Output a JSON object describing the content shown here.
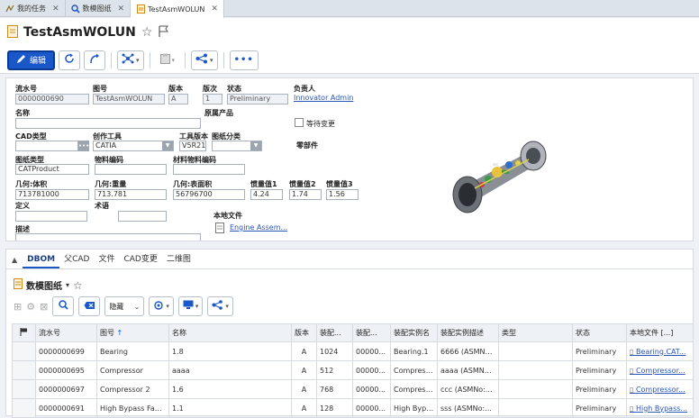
{
  "tabs": [
    {
      "label": "我的任务",
      "icon": "task-icon"
    },
    {
      "label": "数模图纸",
      "icon": "search-icon"
    },
    {
      "label": "TestAsmWOLUN",
      "icon": "document-icon",
      "active": true
    }
  ],
  "header": {
    "title": "TestAsmWOLUN"
  },
  "toolbar": {
    "edit_label": "编辑"
  },
  "form": {
    "lbl_serial": "流水号",
    "serial": "0000000690",
    "lbl_drawing_no": "图号",
    "drawing_no": "TestAsmWOLUN",
    "lbl_version": "版本",
    "version": "A",
    "lbl_revision": "版次",
    "revision": "1",
    "lbl_status": "状态",
    "status": "Preliminary",
    "lbl_owner": "负责人",
    "owner": "Innovator Admin",
    "lbl_name": "名称",
    "lbl_source_product": "原属产品",
    "lbl_pending_change": "等待变更",
    "lbl_cad_type": "CAD类型",
    "lbl_authoring_tool": "创作工具",
    "authoring_tool": "CATIA",
    "lbl_tool_version": "工具版本",
    "tool_version": "V5R21",
    "lbl_drawing_category": "图纸分类",
    "lbl_part": "零部件",
    "lbl_drawing_type": "图纸类型",
    "drawing_type": "CATProduct",
    "lbl_material_code": "物料编码",
    "lbl_material_material_code": "材料物料编码",
    "lbl_volume": "几何:体积",
    "volume": "713781000",
    "lbl_weight": "几何:重量",
    "weight": "713.781",
    "lbl_surface": "几何:表面积",
    "surface": "56796700",
    "lbl_inertia1": "惯量值1",
    "inertia1": "4.24",
    "lbl_inertia2": "惯量值2",
    "inertia2": "1.74",
    "lbl_inertia3": "惯量值3",
    "inertia3": "1.56",
    "lbl_definition": "定义",
    "lbl_term": "术语",
    "lbl_local_file": "本地文件",
    "local_file": "Engine Assem...",
    "lbl_description": "描述"
  },
  "bottom": {
    "subtabs": [
      "DBOM",
      "父CAD",
      "文件",
      "CAD变更",
      "二维图"
    ],
    "section_title": "数模图纸",
    "hide_label": "隐藏",
    "columns": [
      "流水号",
      "图号",
      "名称",
      "版本",
      "装配...",
      "装配...",
      "装配实例名",
      "装配实例描述",
      "类型",
      "状态",
      "本地文件 [...]"
    ],
    "rows": [
      [
        "0000000699",
        "Bearing",
        "1.8",
        "A",
        "1024",
        "00000...",
        "Bearing.1",
        "6666 (ASMNo...",
        "",
        "Preliminary",
        "Bearing.CAT..."
      ],
      [
        "0000000695",
        "Compressor",
        "aaaa",
        "A",
        "512",
        "00000...",
        "Compress...",
        "aaaa (ASMNo...",
        "",
        "Preliminary",
        "Compressor..."
      ],
      [
        "0000000697",
        "Compressor 2",
        "1.6",
        "A",
        "768",
        "00000...",
        "Compress...",
        "ccc (ASMNo:...",
        "",
        "Preliminary",
        "Compressor..."
      ],
      [
        "0000000691",
        "High Bypass Fan ...",
        "1.1",
        "A",
        "128",
        "00000...",
        "High Bypass...",
        "sss (ASMNo:...",
        "",
        "Preliminary",
        "High Bypass..."
      ]
    ]
  },
  "colors": {
    "primary": "#1a57c9",
    "link": "#2a55b8",
    "background": "#eef1f5"
  }
}
